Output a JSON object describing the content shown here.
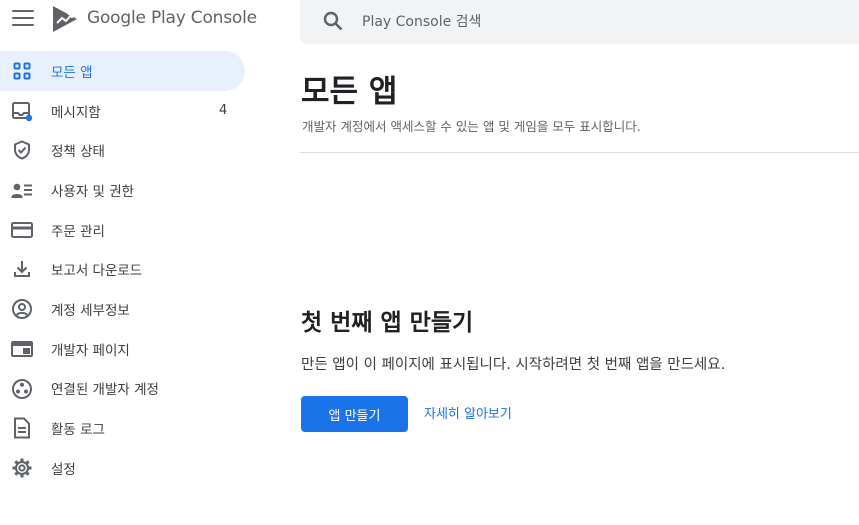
{
  "header": {
    "logo_text": "Google Play Console",
    "search_placeholder": "Play Console 검색"
  },
  "sidebar": {
    "items": [
      {
        "label": "모든 앱",
        "icon": "apps-grid-icon",
        "active": true
      },
      {
        "label": "메시지함",
        "icon": "inbox-icon",
        "badge": "4"
      },
      {
        "label": "정책 상태",
        "icon": "shield-check-icon"
      },
      {
        "label": "사용자 및 권한",
        "icon": "users-list-icon"
      },
      {
        "label": "주문 관리",
        "icon": "credit-card-icon"
      },
      {
        "label": "보고서 다운로드",
        "icon": "download-icon"
      },
      {
        "label": "계정 세부정보",
        "icon": "account-circle-icon"
      },
      {
        "label": "개발자 페이지",
        "icon": "web-page-icon"
      },
      {
        "label": "연결된 개발자 계정",
        "icon": "linked-accounts-icon"
      },
      {
        "label": "활동 로그",
        "icon": "document-icon"
      },
      {
        "label": "설정",
        "icon": "gear-icon"
      }
    ]
  },
  "main": {
    "title": "모든 앱",
    "subtitle": "개발자 계정에서 액세스할 수 있는 앱 및 게임을 모두 표시합니다.",
    "empty_title": "첫 번째 앱 만들기",
    "empty_description": "만든 앱이 이 페이지에 표시됩니다. 시작하려면 첫 번째 앱을 만드세요.",
    "create_button": "앱 만들기",
    "learn_more": "자세히 알아보기"
  },
  "colors": {
    "accent": "#1a73e8",
    "active_bg": "#e8f0fe",
    "icon_gray": "#5f6368",
    "search_bg": "#f1f3f4",
    "divider": "#dadce0"
  }
}
